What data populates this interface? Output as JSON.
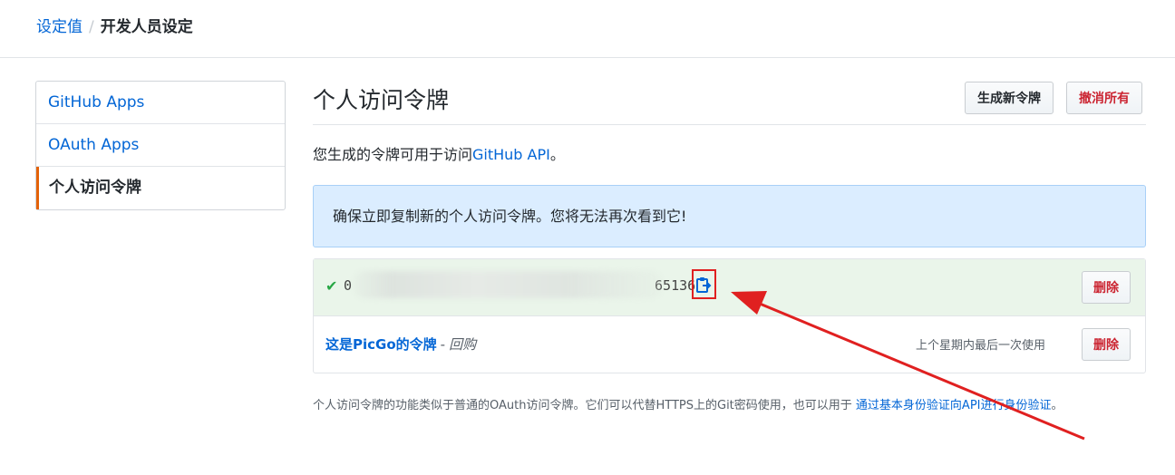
{
  "breadcrumb": {
    "parent": "设定值",
    "separator": "/",
    "current": "开发人员设定"
  },
  "sidebar": {
    "items": [
      {
        "label": "GitHub Apps"
      },
      {
        "label": "OAuth Apps"
      },
      {
        "label": "个人访问令牌",
        "active": true
      }
    ]
  },
  "main": {
    "title": "个人访问令牌",
    "generate_button": "生成新令牌",
    "revoke_all_button": "撤消所有",
    "description_prefix": "您生成的令牌可用于访问",
    "description_link": "GitHub API",
    "description_suffix": "。",
    "flash_message": "确保立即复制新的个人访问令牌。您将无法再次看到它!",
    "new_token": {
      "check_icon": "check-icon",
      "value_start": "0",
      "value_end": "65136",
      "copy_icon": "clipboard-icon",
      "delete_button": "删除"
    },
    "token": {
      "name": "这是PicGo的令牌",
      "dash": "-",
      "scope": "回购",
      "last_used": "上个星期内最后一次使用",
      "delete_button": "删除"
    },
    "note_text": "个人访问令牌的功能类似于普通的OAuth访问令牌。它们可以代替HTTPS上的Git密码使用，也可以用于 ",
    "note_link": "通过基本身份验证向API进行身份验证",
    "note_end": "。"
  },
  "colors": {
    "link": "#0366d6",
    "danger": "#cb2431",
    "success": "#28a745",
    "annotation": "#e02020",
    "flash_bg": "#dbedff"
  }
}
